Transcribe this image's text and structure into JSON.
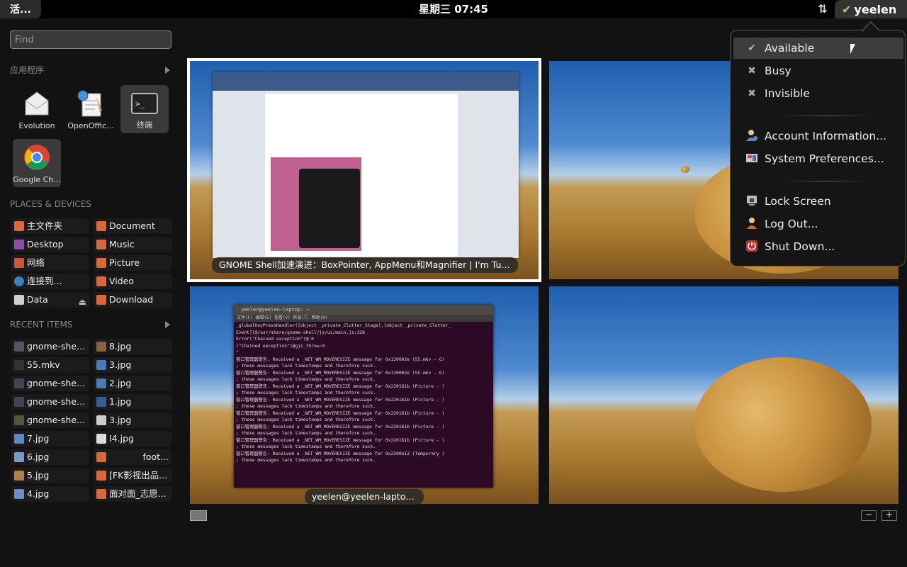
{
  "top_panel": {
    "activities": "活...",
    "clock": "星期三 07:45",
    "user_name": "yeelen"
  },
  "search": {
    "placeholder": "Find"
  },
  "apps": {
    "title": "应用程序",
    "items": [
      {
        "label": "Evolution",
        "icon": "envelope-icon"
      },
      {
        "label": "OpenOffic...",
        "icon": "document-writer-icon"
      },
      {
        "label": "终端",
        "icon": "terminal-icon"
      },
      {
        "label": "Google Ch...",
        "icon": "chrome-icon"
      }
    ]
  },
  "places": {
    "title": "PLACES & DEVICES",
    "left": [
      "主文件夹",
      "Desktop",
      "网络",
      "连接到...",
      "Data"
    ],
    "right": [
      "Document",
      "Music",
      "Picture",
      "Video",
      "Download"
    ]
  },
  "recent": {
    "title": "RECENT ITEMS",
    "left": [
      "gnome-shel...",
      "55.mkv",
      "gnome-shel...",
      "gnome-shel...",
      "gnome-shel...",
      "7.jpg",
      "6.jpg",
      "5.jpg",
      "4.jpg"
    ],
    "right": [
      "8.jpg",
      "3.jpg",
      "2.jpg",
      "1.jpg",
      "3.jpg",
      "I4.jpg",
      "foot...",
      "[FK影视出品...",
      "面对面_志愿..."
    ]
  },
  "windows": {
    "browser_caption": "GNOME Shell加速演进：BoxPointer, AppMenu和Magnifier | I'm Tual...",
    "terminal_caption": "yeelen@yeelen-laptop: ~",
    "terminal_title": "yeelen@yeelen-laptop: ~",
    "terminal_menu": "文件(F)  编辑(E)  查看(V)  终端(T)  帮助(H)",
    "terminal_text": "_globalKeyPressHandler([object _private_Clutter_Stage],[object _private_Clutter_\nEvent])@/usr/share/gnome-shell/js/ui/main.js:328\nError(\"Chained exception\")@:0\n(\"Chained exception\")@gjs_throw:0\n\"\n窗口管理器警告: Received a _NET_WM_MOVERESIZE message for 0x120002e (55.mkv - G)\n; these messages lack timestamps and therefore suck.\n窗口管理器警告: Received a _NET_WM_MOVERESIZE message for 0x120002e (55.mkv - G)\n; these messages lack timestamps and therefore suck.\n窗口管理器警告: Received a _NET_WM_MOVERESIZE message for 0x220161b (Picture - )\n; these messages lack timestamps and therefore suck.\n窗口管理器警告: Received a _NET_WM_MOVERESIZE message for 0x220161b (Picture - )\n; these messages lack timestamps and therefore suck.\n窗口管理器警告: Received a _NET_WM_MOVERESIZE message for 0x220161b (Picture - )\n; these messages lack timestamps and therefore suck.\n窗口管理器警告: Received a _NET_WM_MOVERESIZE message for 0x220161b (Picture - )\n; these messages lack timestamps and therefore suck.\n窗口管理器警告: Received a _NET_WM_MOVERESIZE message for 0x220161b (Picture - )\n; these messages lack timestamps and therefore suck.\n窗口管理器警告: Received a _NET_WM_MOVERESIZE message for 0x2200e12 (Temporary )\n; these messages lack timestamps and therefore suck."
  },
  "status_menu": {
    "available": "Available",
    "busy": "Busy",
    "invisible": "Invisible",
    "account": "Account Information...",
    "preferences": "System Preferences...",
    "lock": "Lock Screen",
    "logout": "Log Out...",
    "shutdown": "Shut Down..."
  },
  "workspace_controls": {
    "zoom_out": "−",
    "zoom_in": "+"
  },
  "colors": {
    "available_check": "#8fd14f",
    "panel_bg": "#000000",
    "overview_bg": "#121212"
  }
}
